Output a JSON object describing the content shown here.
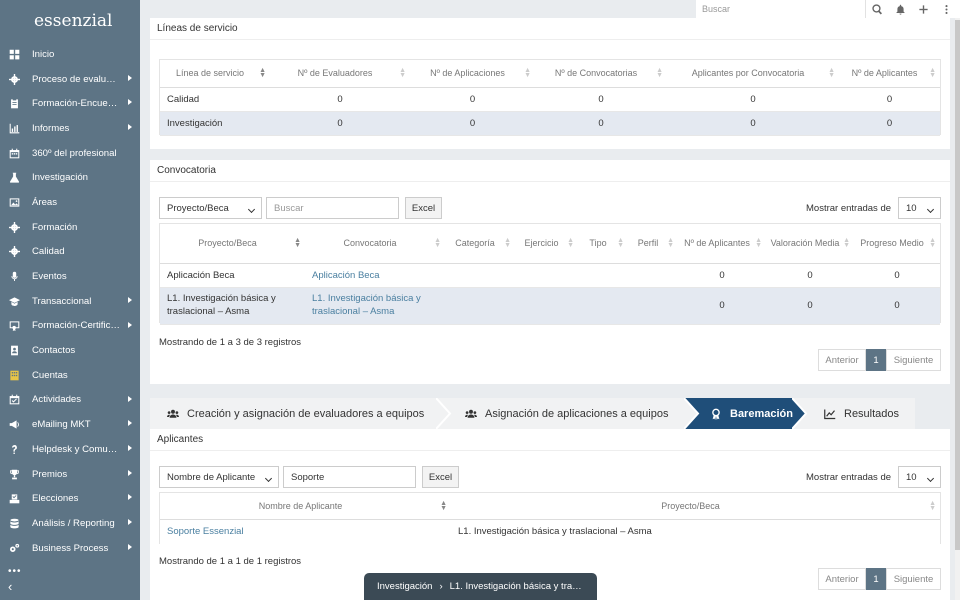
{
  "app": {
    "logo": "essenzial"
  },
  "sidebar": {
    "items": [
      {
        "label": "Inicio",
        "icon": "grid-icon",
        "has_sub": false
      },
      {
        "label": "Proceso de evalua…",
        "icon": "gear-icon",
        "has_sub": true
      },
      {
        "label": "Formación-Encues…",
        "icon": "clipboard-icon",
        "has_sub": true
      },
      {
        "label": "Informes",
        "icon": "chart-icon",
        "has_sub": true
      },
      {
        "label": "360º del profesional",
        "icon": "calendar-icon",
        "has_sub": false
      },
      {
        "label": "Investigación",
        "icon": "flask-icon",
        "has_sub": false
      },
      {
        "label": "Áreas",
        "icon": "image-icon",
        "has_sub": false
      },
      {
        "label": "Formación",
        "icon": "gear-icon",
        "has_sub": false
      },
      {
        "label": "Calidad",
        "icon": "gear-icon",
        "has_sub": false
      },
      {
        "label": "Eventos",
        "icon": "microphone-icon",
        "has_sub": false
      },
      {
        "label": "Transaccional",
        "icon": "graduation-cap-icon",
        "has_sub": true
      },
      {
        "label": "Formación-Certific…",
        "icon": "certificate-icon",
        "has_sub": true
      },
      {
        "label": "Contactos",
        "icon": "contact-icon",
        "has_sub": false
      },
      {
        "label": "Cuentas",
        "icon": "building-icon",
        "has_sub": false
      },
      {
        "label": "Actividades",
        "icon": "calendar-check-icon",
        "has_sub": true
      },
      {
        "label": "eMailing MKT",
        "icon": "megaphone-icon",
        "has_sub": true
      },
      {
        "label": "Helpdesk y Comun…",
        "icon": "question-icon",
        "has_sub": true
      },
      {
        "label": "Premios",
        "icon": "trophy-icon",
        "has_sub": true
      },
      {
        "label": "Elecciones",
        "icon": "vote-icon",
        "has_sub": true
      },
      {
        "label": "Análisis / Reporting",
        "icon": "database-icon",
        "has_sub": true
      },
      {
        "label": "Business Process",
        "icon": "cogs-icon",
        "has_sub": true
      }
    ],
    "more": "•••",
    "collapse": "‹"
  },
  "topbar": {
    "search_placeholder": "Buscar"
  },
  "lineas": {
    "title": "Líneas de servicio",
    "columns": [
      "Línea de servicio",
      "Nº de Evaluadores",
      "Nº de Aplicaciones",
      "Nº de Convocatorias",
      "Aplicantes por Convocatoria",
      "Nº de Aplicantes"
    ],
    "rows": [
      [
        "Calidad",
        "0",
        "0",
        "0",
        "0",
        "0"
      ],
      [
        "Investigación",
        "0",
        "0",
        "0",
        "0",
        "0"
      ]
    ]
  },
  "convocatoria": {
    "title": "Convocatoria",
    "select_value": "Proyecto/Beca",
    "search_placeholder": "Buscar",
    "excel_label": "Excel",
    "show_label": "Mostrar entradas de",
    "show_value": "10",
    "columns": [
      "Proyecto/Beca",
      "Convocatoria",
      "Categoría",
      "Ejercicio",
      "Tipo",
      "Perfil",
      "Nº de Aplicantes",
      "Valoración Media",
      "Progreso Medio"
    ],
    "rows": [
      [
        "Aplicación Beca",
        "Aplicación Beca",
        "",
        "",
        "",
        "",
        "0",
        "0",
        "0"
      ],
      [
        "L1. Investigación básica y traslacional – Asma",
        "L1. Investigación básica y traslacional – Asma",
        "",
        "",
        "",
        "",
        "0",
        "0",
        "0"
      ]
    ],
    "info": "Mostrando de 1 a 3 de 3 registros",
    "prev": "Anterior",
    "page": "1",
    "next": "Siguiente"
  },
  "steps": [
    {
      "label": "Creación y asignación de evaluadores a equipos",
      "icon": "users-icon",
      "active": false
    },
    {
      "label": "Asignación de aplicaciones a equipos",
      "icon": "users-icon",
      "active": false
    },
    {
      "label": "Baremación",
      "icon": "award-icon",
      "active": true
    },
    {
      "label": "Resultados",
      "icon": "chart-line-icon",
      "active": false
    }
  ],
  "aplicantes": {
    "title": "Aplicantes",
    "select_value": "Nombre de Aplicante",
    "search_value": "Soporte",
    "excel_label": "Excel",
    "show_label": "Mostrar entradas de",
    "show_value": "10",
    "columns": [
      "Nombre de Aplicante",
      "Proyecto/Beca"
    ],
    "rows": [
      [
        "Soporte Essenzial",
        "L1. Investigación básica y traslacional – Asma"
      ]
    ],
    "info": "Mostrando de 1 a 1 de 1 registros",
    "prev": "Anterior",
    "page": "1",
    "next": "Siguiente"
  },
  "breadcrumb": {
    "items": [
      "Investigación",
      "L1. Investigación básica y tra…"
    ],
    "separator": "›"
  },
  "colors": {
    "sidebar": "#5d7485",
    "active_step": "#1f4e79",
    "highlight_row": "#e4e9f1",
    "breadcrumb_bg": "#3b4a55"
  }
}
